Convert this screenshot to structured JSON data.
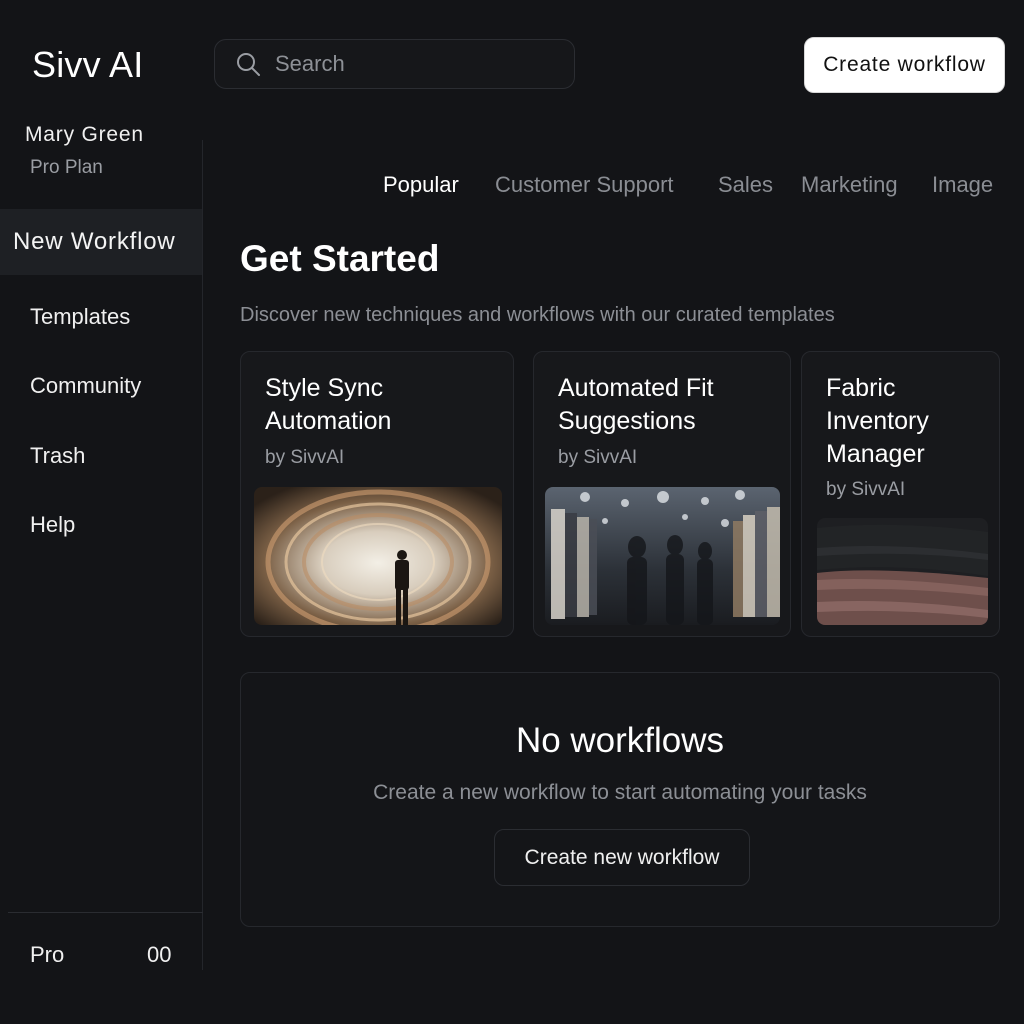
{
  "app": {
    "brand": "Sivv AI"
  },
  "user": {
    "name": "Mary Green",
    "plan": "Pro Plan"
  },
  "sidebar": {
    "active_label": "New Workflow",
    "items": [
      {
        "label": "Templates"
      },
      {
        "label": "Community"
      },
      {
        "label": "Trash"
      },
      {
        "label": "Help"
      }
    ],
    "footer": {
      "left": "Pro",
      "right": "00"
    }
  },
  "search": {
    "placeholder": "Search",
    "icon": "search-icon"
  },
  "header": {
    "create_label": "Create workflow"
  },
  "tabs": [
    {
      "label": "Popular",
      "active": true
    },
    {
      "label": "Customer Support",
      "active": false
    },
    {
      "label": "Sales",
      "active": false
    },
    {
      "label": "Marketing",
      "active": false
    },
    {
      "label": "Image",
      "active": false
    }
  ],
  "main": {
    "title": "Get Started",
    "subtitle": "Discover new techniques and workflows with our curated templates"
  },
  "templates": [
    {
      "title": "Style Sync Automation",
      "author": "by SivvAI",
      "image": "portal-swirl-figure"
    },
    {
      "title": "Automated Fit Suggestions",
      "author": "by SivvAI",
      "image": "clothing-store-blur"
    },
    {
      "title": "Fabric Inventory Manager",
      "author": "by SivvAI",
      "image": "folded-fabric"
    }
  ],
  "empty_state": {
    "title": "No workflows",
    "subtitle": "Create a new workflow to start automating your tasks",
    "button_label": "Create new workflow"
  }
}
